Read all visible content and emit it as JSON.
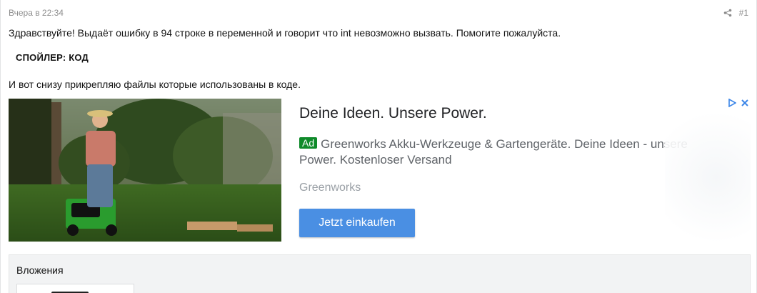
{
  "post": {
    "date": "Вчера в 22:34",
    "number": "#1",
    "share_icon": "share-icon",
    "message_line1": "Здравствуйте! Выдаёт ошибку в 94 строке в переменной и говорит что int невозможно вызвать. Помогите пожалуйста.",
    "spoiler_label": "СПОЙЛЕР: КОД",
    "message_line2": "И вот снизу прикрепляю файлы которые использованы в коде."
  },
  "ad": {
    "title": "Deine Ideen. Unsere Power.",
    "badge": "Ad",
    "description": "Greenworks Akku-Werkzeuge & Gartengeräte. Deine Ideen - unsere Power. Kostenloser Versand",
    "brand": "Greenworks",
    "cta_label": "Jetzt einkaufen",
    "badge_color": "#0f8a2a",
    "cta_color": "#4a8fe3",
    "adchoices_icon": "adchoices-icon",
    "close_icon": "close-icon"
  },
  "attachments": {
    "title": "Вложения"
  }
}
